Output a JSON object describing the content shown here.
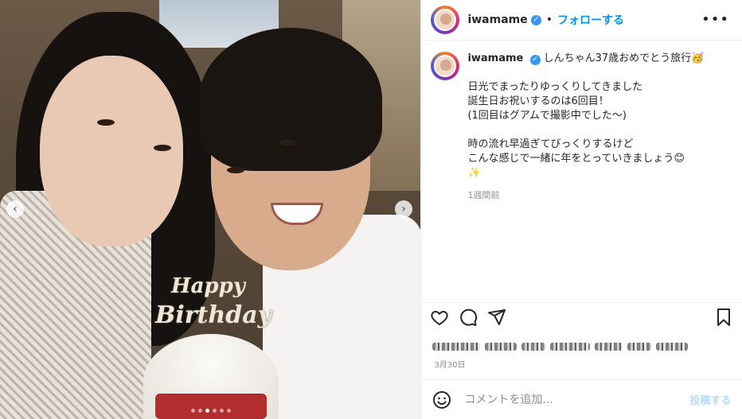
{
  "header": {
    "username": "iwamame",
    "separator": "•",
    "follow_label": "フォローする",
    "more_icon": "•••"
  },
  "photo": {
    "topper_line1": "Happy",
    "topper_line2": "Birthday",
    "dot_count": 6,
    "active_dot": 2
  },
  "caption": {
    "username": "iwamame",
    "line1": "しんちゃん37歳おめでとう旅行🥳",
    "line2": "日光でまったりゆっくりしてきました",
    "line3": "誕生日お祝いするのは6回目！",
    "line4": "(1回目はグアムで撮影中でした〜)",
    "line5": "時の流れ早過ぎてびっくりするけど",
    "line6": "こんな感じで一緒に年をとっていきましょう😊",
    "line7": "✨",
    "time": "1週間前"
  },
  "meta": {
    "date": "3月30日"
  },
  "comment": {
    "placeholder": "コメントを追加...",
    "post_label": "投稿する"
  },
  "colors": {
    "accent": "#0095f6",
    "verified": "#3897f0",
    "post_disabled": "#b3dbff"
  }
}
